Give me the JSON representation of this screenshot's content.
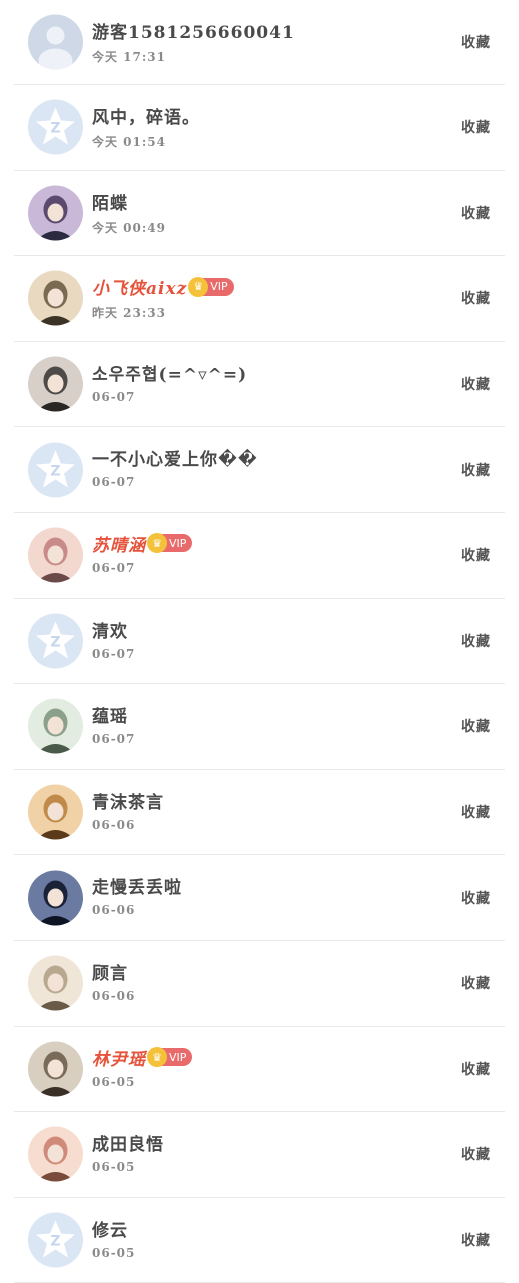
{
  "favorite_label": "收藏",
  "vip_badge_text": "VIP",
  "colors": {
    "vip_name": "#e5533c",
    "vip_badge": "#e86a6a",
    "crown": "#f4c23a",
    "default_avatar_bg": "#dbe6f4"
  },
  "visitors": [
    {
      "name": "游客1581256660041",
      "time": "今天 17:31",
      "vip": false,
      "avatar": "guest-avatar"
    },
    {
      "name": "风中，碎语。",
      "time": "今天 01:54",
      "vip": false,
      "avatar": "default-qzone-avatar"
    },
    {
      "name": "陌蝶",
      "time": "今天 00:49",
      "vip": false,
      "avatar": "user-photo-avatar"
    },
    {
      "name": "小飞侠aixz",
      "time": "昨天 23:33",
      "vip": true,
      "avatar": "user-photo-avatar"
    },
    {
      "name": "소우주협(=^▿^=)",
      "time": "06-07",
      "vip": false,
      "avatar": "user-photo-avatar"
    },
    {
      "name": "一不小心爱上你��",
      "time": "06-07",
      "vip": false,
      "avatar": "default-qzone-avatar"
    },
    {
      "name": "苏晴涵",
      "time": "06-07",
      "vip": true,
      "avatar": "user-photo-avatar"
    },
    {
      "name": "清欢",
      "time": "06-07",
      "vip": false,
      "avatar": "default-qzone-avatar"
    },
    {
      "name": "蕴瑶",
      "time": "06-07",
      "vip": false,
      "avatar": "user-photo-avatar"
    },
    {
      "name": "青沫茶言",
      "time": "06-06",
      "vip": false,
      "avatar": "user-photo-avatar"
    },
    {
      "name": "走慢丢丢啦",
      "time": "06-06",
      "vip": false,
      "avatar": "user-photo-avatar"
    },
    {
      "name": "顾言",
      "time": "06-06",
      "vip": false,
      "avatar": "user-photo-avatar"
    },
    {
      "name": "林尹瑶",
      "time": "06-05",
      "vip": true,
      "avatar": "user-photo-avatar"
    },
    {
      "name": "成田良悟",
      "time": "06-05",
      "vip": false,
      "avatar": "user-photo-avatar"
    },
    {
      "name": "修云",
      "time": "06-05",
      "vip": false,
      "avatar": "default-qzone-avatar"
    }
  ]
}
